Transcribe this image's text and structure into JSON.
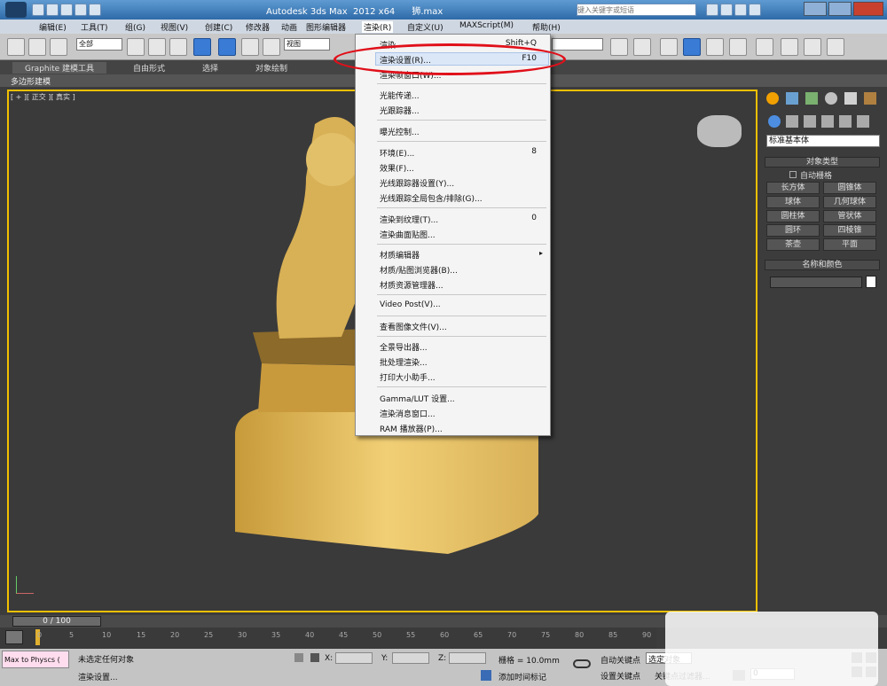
{
  "window": {
    "title": "Autodesk 3ds Max  2012 x64      狮.max",
    "search_placeholder": "键入关键字或短语"
  },
  "menubar": [
    "编辑(E)",
    "工具(T)",
    "组(G)",
    "视图(V)",
    "创建(C)",
    "修改器",
    "动画",
    "图形编辑器",
    "渲染(R)",
    "自定义(U)",
    "MAXScript(M)",
    "帮助(H)"
  ],
  "toolbar": {
    "selection_filter": "全部",
    "ref_coord": "视图"
  },
  "ribbon": {
    "tabs": [
      "Graphite 建模工具",
      "自由形式",
      "选择",
      "对象绘制"
    ],
    "sub": "多边形建模"
  },
  "viewport": {
    "label": "[ + ][ 正交 ][ 真实 ]"
  },
  "render_menu": {
    "items": [
      {
        "label": "渲染",
        "shortcut": "Shift+Q"
      },
      {
        "label": "渲染设置(R)...",
        "shortcut": "F10"
      },
      {
        "label": "渲染帧窗口(W)...",
        "shortcut": ""
      },
      {
        "label": "光能传递...",
        "shortcut": ""
      },
      {
        "label": "光跟踪器...",
        "shortcut": ""
      },
      {
        "label": "曝光控制...",
        "shortcut": ""
      },
      {
        "label": "环境(E)...",
        "shortcut": "8"
      },
      {
        "label": "效果(F)...",
        "shortcut": ""
      },
      {
        "label": "光线跟踪器设置(Y)...",
        "shortcut": ""
      },
      {
        "label": "光线跟踪全局包含/排除(G)...",
        "shortcut": ""
      },
      {
        "label": "渲染到纹理(T)...",
        "shortcut": "0"
      },
      {
        "label": "渲染曲面贴图...",
        "shortcut": ""
      },
      {
        "label": "材质编辑器",
        "shortcut": ""
      },
      {
        "label": "材质/贴图浏览器(B)...",
        "shortcut": ""
      },
      {
        "label": "材质资源管理器...",
        "shortcut": ""
      },
      {
        "label": "Video Post(V)...",
        "shortcut": ""
      },
      {
        "label": "查看图像文件(V)...",
        "shortcut": ""
      },
      {
        "label": "全景导出器...",
        "shortcut": ""
      },
      {
        "label": "批处理渲染...",
        "shortcut": ""
      },
      {
        "label": "打印大小助手...",
        "shortcut": ""
      },
      {
        "label": "Gamma/LUT 设置...",
        "shortcut": ""
      },
      {
        "label": "渲染消息窗口...",
        "shortcut": ""
      },
      {
        "label": "RAM 播放器(P)...",
        "shortcut": ""
      }
    ]
  },
  "command_panel": {
    "category": "标准基本体",
    "object_type_title": "对象类型",
    "autogrid": "自动栅格",
    "buttons": [
      "长方体",
      "圆锥体",
      "球体",
      "几何球体",
      "圆柱体",
      "管状体",
      "圆环",
      "四棱锥",
      "茶壶",
      "平面"
    ],
    "name_color_title": "名称和颜色"
  },
  "timeline": {
    "frame": "0 / 100",
    "ticks": [
      "0",
      "5",
      "10",
      "15",
      "20",
      "25",
      "30",
      "35",
      "40",
      "45",
      "50",
      "55",
      "60",
      "65",
      "70",
      "75",
      "80",
      "85",
      "90"
    ]
  },
  "status": {
    "script_box": "Max to Physcs (",
    "selection": "未选定任何对象",
    "prompt": "渲染设置...",
    "x_label": "X:",
    "y_label": "Y:",
    "z_label": "Z:",
    "grid": "栅格 = 10.0mm",
    "add_time_tag": "添加时间标记",
    "auto_key": "自动关键点",
    "selected": "选定对象",
    "set_key": "设置关键点",
    "key_filters": "关键点过滤器...",
    "frame_field": "0"
  }
}
